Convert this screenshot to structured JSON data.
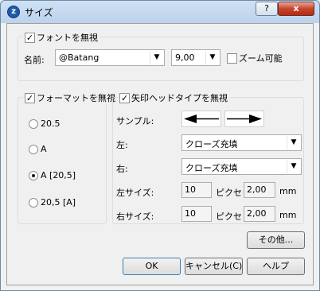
{
  "window": {
    "title": "サイズ",
    "help_glyph": "?",
    "close_glyph": "x",
    "icon": "app-logo-icon"
  },
  "font_group": {
    "title": "フォントを無視",
    "checked": true,
    "name_label": "名前:",
    "font_name": "@Batang",
    "font_size": "9,00",
    "zoom_label": "ズーム可能",
    "zoom_checked": false
  },
  "format_group": {
    "title": "フォーマットを無視",
    "checked": true,
    "options": [
      "20.5",
      "A",
      "A [20,5]",
      "20,5 [A]"
    ],
    "selected_index": 2
  },
  "arrow_group": {
    "title": "矢印ヘッドタイプを無視",
    "checked": true,
    "sample_label": "サンプル:",
    "left_label": "左:",
    "left_value": "クローズ充填",
    "right_label": "右:",
    "right_value": "クローズ充填",
    "left_size_label": "左サイズ:",
    "left_size_px": "10",
    "px_unit": "ピクセ",
    "left_size_mm": "2,00",
    "mm_unit": "mm",
    "right_size_label": "右サイズ:",
    "right_size_px": "10",
    "right_size_mm": "2,00"
  },
  "buttons": {
    "other": "その他...",
    "ok": "OK",
    "cancel": "キャンセル(C)",
    "help": "ヘルプ"
  }
}
